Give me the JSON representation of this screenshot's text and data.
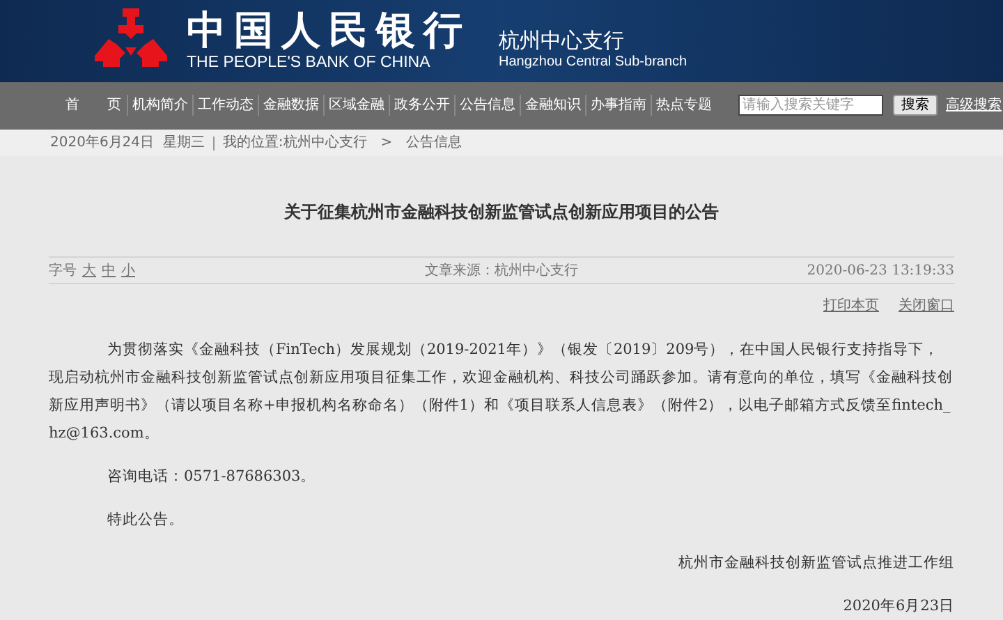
{
  "header": {
    "bank_name": "中国人民银行",
    "bank_name_en": "THE PEOPLE'S BANK OF CHINA",
    "branch": "杭州中心支行",
    "branch_en": "Hangzhou Central Sub-branch"
  },
  "nav": {
    "items": [
      {
        "label": "首　　页"
      },
      {
        "label": "机构简介"
      },
      {
        "label": "工作动态"
      },
      {
        "label": "金融数据"
      },
      {
        "label": "区域金融"
      },
      {
        "label": "政务公开"
      },
      {
        "label": "公告信息"
      },
      {
        "label": "金融知识"
      },
      {
        "label": "办事指南"
      },
      {
        "label": "热点专题"
      }
    ],
    "search": {
      "placeholder": "请输入搜索关键字"
    },
    "search_button": "搜索",
    "advanced_search": "高级搜索"
  },
  "breadcrumb": {
    "date": "2020年6月24日  星期三",
    "location": "我的位置:杭州中心支行",
    "separator": ">",
    "current": "公告信息"
  },
  "article": {
    "title": "关于征集杭州市金融科技创新监管试点创新应用项目的公告",
    "font_size_label": "字号",
    "font_sizes": [
      {
        "label": "大"
      },
      {
        "label": "中"
      },
      {
        "label": "小"
      }
    ],
    "source": "文章来源：杭州中心支行",
    "datetime": "2020-06-23 13:19:33",
    "actions": [
      {
        "label": "打印本页"
      },
      {
        "label": "关闭窗口"
      }
    ],
    "paragraphs": [
      "为贯彻落实《金融科技（FinTech）发展规划（2019-2021年）》（银发〔2019〕209号），在中国人民银行支持指导下，现启动杭州市金融科技创新监管试点创新应用项目征集工作，欢迎金融机构、科技公司踊跃参加。请有意向的单位，填写《金融科技创新应用声明书》（请以项目名称+申报机构名称命名）（附件1）和《项目联系人信息表》（附件2），以电子邮箱方式反馈至fintech_hz@163.com。",
      "咨询电话：0571-87686303。",
      "特此公告。"
    ],
    "signature": "杭州市金融科技创新监管试点推进工作组",
    "date": "2020年6月23日"
  }
}
